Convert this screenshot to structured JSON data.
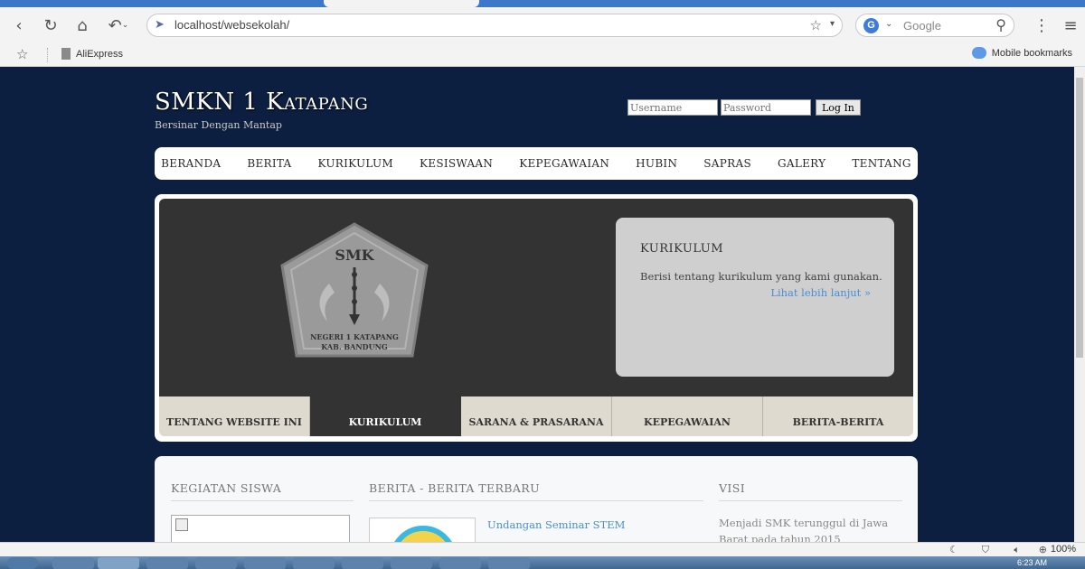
{
  "browser": {
    "url": "localhost/websekolah/",
    "search_placeholder": "Google",
    "bookmarks": [
      {
        "label": "AliExpress"
      }
    ],
    "mobile_bookmarks": "Mobile bookmarks",
    "zoom": "100%",
    "clock": "6:23 AM"
  },
  "site": {
    "title": "SMKN 1 Katapang",
    "subtitle": "Bersinar Dengan Mantap",
    "login": {
      "username_placeholder": "Username",
      "password_placeholder": "Password",
      "button": "Log In"
    },
    "menu": [
      "BERANDA",
      "BERITA",
      "KURIKULUM",
      "KESISWAAN",
      "KEPEGAWAIAN",
      "HUBIN",
      "SAPRAS",
      "GALERY",
      "TENTANG"
    ],
    "logo": {
      "top_text": "SMK",
      "line1": "NEGERI 1 KATAPANG",
      "line2": "KAB. BANDUNG"
    },
    "feature": {
      "heading": "KURIKULUM",
      "body": "Berisi tentang kurikulum yang kami gunakan.",
      "link": "Lihat lebih lanjut »"
    },
    "feature_tabs": [
      {
        "label": "TENTANG WEBSITE INI",
        "active": false
      },
      {
        "label": "KURIKULUM",
        "active": true
      },
      {
        "label": "SARANA & PRASARANA",
        "active": false
      },
      {
        "label": "KEPEGAWAIAN",
        "active": false
      },
      {
        "label": "BERITA-BERITA",
        "active": false
      }
    ],
    "columns": {
      "kegiatan": {
        "title": "KEGIATAN SISWA"
      },
      "berita": {
        "title": "BERITA - BERITA TERBARU",
        "items": [
          {
            "title": "Undangan Seminar STEM"
          }
        ]
      },
      "visi": {
        "title": "VISI",
        "text": "Menjadi SMK terunggul di Jawa Barat pada tahun 2015"
      }
    }
  },
  "colors": {
    "page_bg": "#0d1f40",
    "link": "#4a8fd4",
    "tab_active": "#333333",
    "tab_inactive": "#dedad0"
  }
}
